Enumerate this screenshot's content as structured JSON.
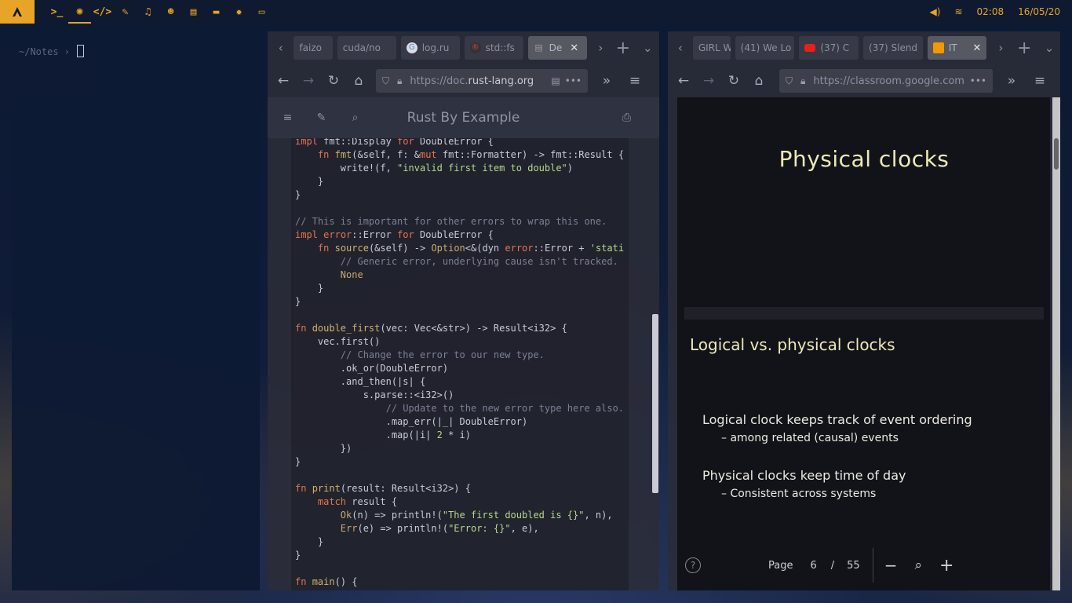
{
  "topbar": {
    "icons": [
      "terminal-icon",
      "globe-icon",
      "code-icon",
      "brush-icon",
      "music-icon",
      "users-icon",
      "drawer-icon",
      "folder-icon",
      "gear-icon",
      "monitor-icon"
    ],
    "glyphs": [
      ">_",
      "◉",
      "</>",
      "✎",
      "♫",
      "☻",
      "▤",
      "▬",
      "✹",
      "▭"
    ],
    "volume": "◀)",
    "wifi": "≋",
    "time": "02:08",
    "date": "16/05/20",
    "accent": "#e8a427"
  },
  "terminal": {
    "prompt": "~/Notes ›"
  },
  "browser1": {
    "tabs": [
      {
        "label": "faizo",
        "fav": ""
      },
      {
        "label": "cuda/no",
        "fav": ""
      },
      {
        "label": "log.ru",
        "fav": "G"
      },
      {
        "label": "std::fs",
        "fav": "®"
      },
      {
        "label": "De",
        "fav": "▤"
      }
    ],
    "url_prefix": "https://doc.",
    "url_domain": "rust-lang.org",
    "page_title": "Rust By Example"
  },
  "browser2": {
    "tabs": [
      {
        "label": "GIRL W"
      },
      {
        "label": "(41) We Lo"
      },
      {
        "label": "(37) C"
      },
      {
        "label": "(37) Slend"
      },
      {
        "label": "IT"
      }
    ],
    "url": "https://classroom.google.com",
    "slide": {
      "title": "Physical clocks",
      "heading": "Logical vs. physical clocks",
      "bullet1": "Logical clock keeps track of event ordering",
      "sub1": "– among related (causal) events",
      "bullet2": "Physical clocks keep time of day",
      "sub2": "– Consistent across systems"
    },
    "pager": {
      "label": "Page",
      "current": "6",
      "sep": "/",
      "total": "55"
    }
  }
}
